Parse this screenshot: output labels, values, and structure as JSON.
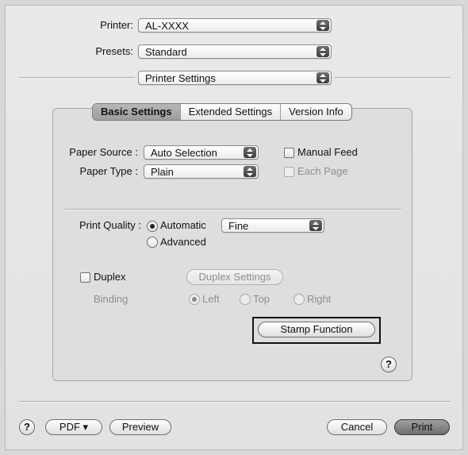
{
  "printer": {
    "label": "Printer:",
    "value": "AL-XXXX"
  },
  "presets": {
    "label": "Presets:",
    "value": "Standard"
  },
  "panel_select": {
    "value": "Printer Settings"
  },
  "tabs": [
    {
      "label": "Basic Settings",
      "selected": true
    },
    {
      "label": "Extended Settings",
      "selected": false
    },
    {
      "label": "Version Info",
      "selected": false
    }
  ],
  "paper_source": {
    "label": "Paper Source :",
    "value": "Auto Selection"
  },
  "paper_type": {
    "label": "Paper Type :",
    "value": "Plain"
  },
  "manual_feed": {
    "label": "Manual Feed",
    "checked": false
  },
  "each_page": {
    "label": "Each Page",
    "checked": false,
    "enabled": false
  },
  "print_quality": {
    "label": "Print Quality :",
    "automatic_label": "Automatic",
    "advanced_label": "Advanced",
    "selected": "Automatic",
    "quality_value": "Fine"
  },
  "duplex": {
    "label": "Duplex",
    "checked": false
  },
  "duplex_settings": {
    "label": "Duplex Settings"
  },
  "binding": {
    "label": "Binding",
    "left_label": "Left",
    "top_label": "Top",
    "right_label": "Right",
    "selected": "Left"
  },
  "stamp_function": {
    "label": "Stamp Function"
  },
  "footer": {
    "pdf_label": "PDF ▾",
    "preview_label": "Preview",
    "cancel_label": "Cancel",
    "print_label": "Print"
  },
  "help_glyph": "?"
}
